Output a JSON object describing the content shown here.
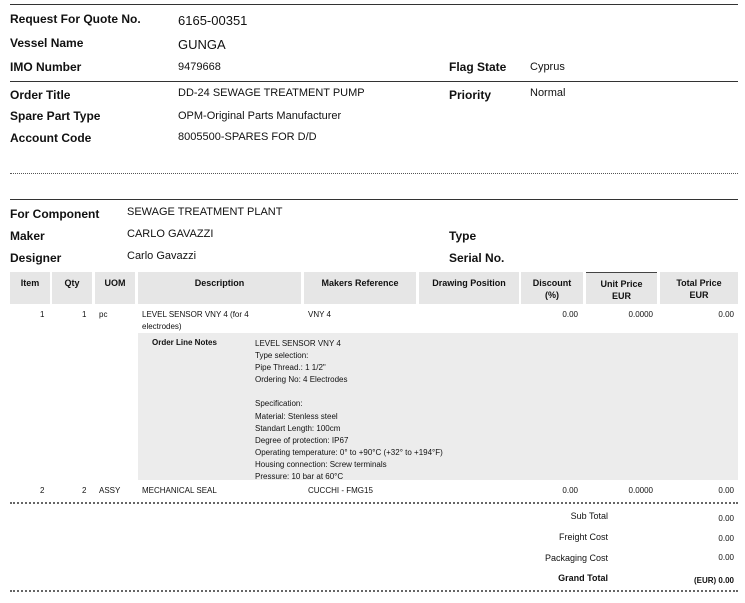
{
  "header": {
    "rfq_label": "Request For Quote No.",
    "rfq_value": "6165-00351",
    "vessel_label": "Vessel Name",
    "vessel_value": "GUNGA",
    "imo_label": "IMO Number",
    "imo_value": "9479668",
    "flag_label": "Flag State",
    "flag_value": "Cyprus",
    "order_label": "Order Title",
    "order_value": "DD-24 SEWAGE TREATMENT PUMP",
    "priority_label": "Priority",
    "priority_value": "Normal",
    "spare_label": "Spare Part Type",
    "spare_value": "OPM-Original Parts Manufacturer",
    "account_label": "Account Code",
    "account_value": "8005500-SPARES FOR D/D"
  },
  "component": {
    "for_label": "For Component",
    "for_value": "SEWAGE TREATMENT PLANT",
    "maker_label": "Maker",
    "maker_value": "CARLO GAVAZZI",
    "type_label": "Type",
    "designer_label": "Designer",
    "designer_value": "Carlo Gavazzi",
    "serial_label": "Serial No."
  },
  "table": {
    "headers": {
      "item": "Item",
      "qty": "Qty",
      "uom": "UOM",
      "description": "Description",
      "makers_ref": "Makers Reference",
      "drawing_pos": "Drawing Position",
      "discount": "Discount",
      "discount_unit": "(%)",
      "unit_price": "Unit Price",
      "unit_price_cur": "EUR",
      "total_price": "Total Price",
      "total_price_cur": "EUR"
    },
    "rows": [
      {
        "item": "1",
        "qty": "1",
        "uom": "pc",
        "description_1": "LEVEL SENSOR VNY 4 (for 4",
        "description_2": "electrodes)",
        "makers_ref": "VNY 4",
        "discount": "0.00",
        "unit_price": "0.0000",
        "total": "0.00"
      },
      {
        "item": "2",
        "qty": "2",
        "uom": "ASSY",
        "description_1": "MECHANICAL SEAL",
        "makers_ref": "CUCCHI - FMG15",
        "discount": "0.00",
        "unit_price": "0.0000",
        "total": "0.00"
      }
    ],
    "notes_label": "Order Line Notes",
    "notes": [
      "LEVEL SENSOR VNY 4",
      "Type selection:",
      "Pipe Thread.: 1 1/2\"",
      "Ordering No: 4 Electrodes",
      "",
      "Specification:",
      "Material: Stenless steel",
      "Standart Length: 100cm",
      "Degree of protection: IP67",
      "Operating temperature: 0° to +90°C (+32° to +194°F)",
      "Housing connection: Screw terminals",
      "Pressure: 10 bar at 60°C"
    ]
  },
  "totals": {
    "subtotal_label": "Sub Total",
    "subtotal": "0.00",
    "freight_label": "Freight Cost",
    "freight": "0.00",
    "packaging_label": "Packaging Cost",
    "packaging": "0.00",
    "grand_label": "Grand Total",
    "grand": "(EUR) 0.00"
  }
}
